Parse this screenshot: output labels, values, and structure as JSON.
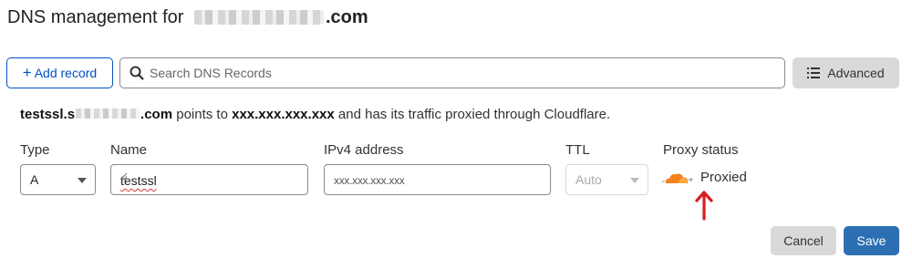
{
  "header": {
    "title_prefix": "DNS management for ",
    "domain_tld": ".com"
  },
  "toolbar": {
    "add_record_label": "Add record",
    "search_placeholder": "Search DNS Records",
    "advanced_label": "Advanced"
  },
  "summary": {
    "record_name": "testssl.s",
    "record_tld": ".com",
    "points_to_text": " points to ",
    "target_ip": "xxx.xxx.xxx.xxx",
    "tail_text": " and has its traffic proxied through Cloudflare."
  },
  "form": {
    "type_label": "Type",
    "type_value": "A",
    "name_label": "Name",
    "name_value": "testssl",
    "ipv4_label": "IPv4 address",
    "ipv4_value": "xxx.xxx.xxx.xxx",
    "ttl_label": "TTL",
    "ttl_value": "Auto",
    "proxy_label": "Proxy status",
    "proxy_value": "Proxied"
  },
  "actions": {
    "cancel_label": "Cancel",
    "save_label": "Save"
  },
  "colors": {
    "accent_blue": "#0051c3",
    "save_blue": "#2c6fb3",
    "cloud_orange": "#f6821f",
    "annotation_red": "#d62020"
  }
}
